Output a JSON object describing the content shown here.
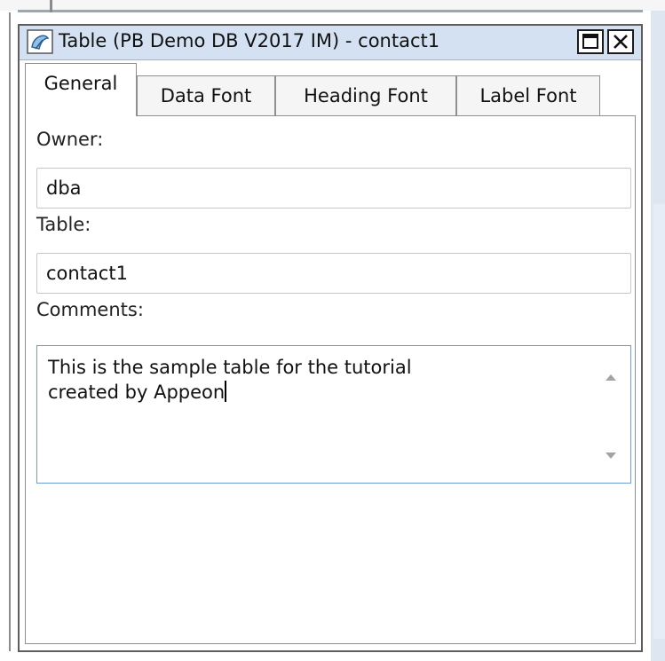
{
  "window": {
    "title": "Table (PB Demo DB V2017 IM) - contact1"
  },
  "tabs": [
    {
      "label": "General",
      "active": true
    },
    {
      "label": "Data Font",
      "active": false
    },
    {
      "label": "Heading Font",
      "active": false
    },
    {
      "label": "Label Font",
      "active": false
    }
  ],
  "fields": {
    "owner_label": "Owner:",
    "owner_value": "dba",
    "table_label": "Table:",
    "table_value": "contact1",
    "comments_label": "Comments:",
    "comments_value": "This is the sample table for the tutorial\ncreated by Appeon"
  },
  "icons": {
    "app": "table-properties-icon",
    "maximize": "maximize-icon",
    "close": "close-icon",
    "scroll_up": "scroll-up-arrow-icon",
    "scroll_down": "scroll-down-arrow-icon"
  },
  "colors": {
    "titlebar": "#d3e1f2",
    "textarea_focus_border": "#6f9cd6"
  }
}
